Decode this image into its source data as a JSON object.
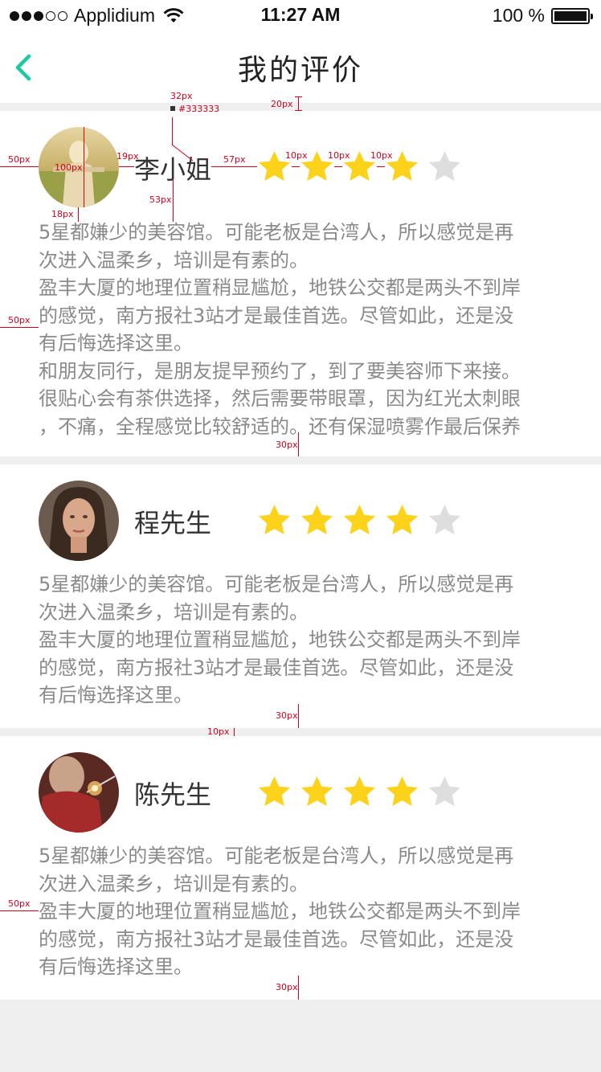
{
  "status_bar": {
    "carrier": "Applidium",
    "time": "11:27 AM",
    "battery": "100 %"
  },
  "nav": {
    "title": "我的评价",
    "back_icon": "chevron-left-icon",
    "accent": "#1dc9a0"
  },
  "reviews": [
    {
      "name": "李小姐",
      "rating": 4,
      "max_rating": 5,
      "lines": [
        "5星都嫌少的美容馆。可能老板是台湾人，所以感觉是再",
        "次进入温柔乡，培训是有素的。",
        "盈丰大厦的地理位置稍显尴尬，地铁公交都是两头不到岸",
        "的感觉，南方报社3站才是最佳首选。尽管如此，还是没",
        "有后悔选择这里。",
        "和朋友同行，是朋友提早预约了，到了要美容师下来接。",
        "很贴心会有茶供选择，然后需要带眼罩，因为红光太刺眼",
        "，不痛，全程感觉比较舒适的。还有保湿喷雾作最后保养"
      ]
    },
    {
      "name": "程先生",
      "rating": 4,
      "max_rating": 5,
      "lines": [
        "5星都嫌少的美容馆。可能老板是台湾人，所以感觉是再",
        "次进入温柔乡，培训是有素的。",
        "盈丰大厦的地理位置稍显尴尬，地铁公交都是两头不到岸",
        "的感觉，南方报社3站才是最佳首选。尽管如此，还是没",
        "有后悔选择这里。"
      ]
    },
    {
      "name": "陈先生",
      "rating": 4,
      "max_rating": 5,
      "lines": [
        "5星都嫌少的美容馆。可能老板是台湾人，所以感觉是再",
        "次进入温柔乡，培训是有素的。",
        "盈丰大厦的地理位置稍显尴尬，地铁公交都是两头不到岸",
        "的感觉，南方报社3站才是最佳首选。尽管如此，还是没",
        "有后悔选择这里。"
      ]
    }
  ],
  "colors": {
    "star_on": "#fdd21a",
    "star_off": "#dedede",
    "review_text": "#8a8a8a",
    "name_text": "#333333",
    "annotation": "#d0021b"
  },
  "annotations": {
    "a32": "32px",
    "a333": "#333333",
    "a20": "20px",
    "a50a": "50px",
    "a100": "100px",
    "a19": "19px",
    "a57": "57px",
    "a10a": "10px",
    "a10b": "10px",
    "a10c": "10px",
    "a53": "53px",
    "a18": "18px",
    "a50b": "50px",
    "a30a": "30px",
    "a30b": "30px",
    "a10d": "10px",
    "a50c": "50px",
    "a30c": "30px"
  }
}
